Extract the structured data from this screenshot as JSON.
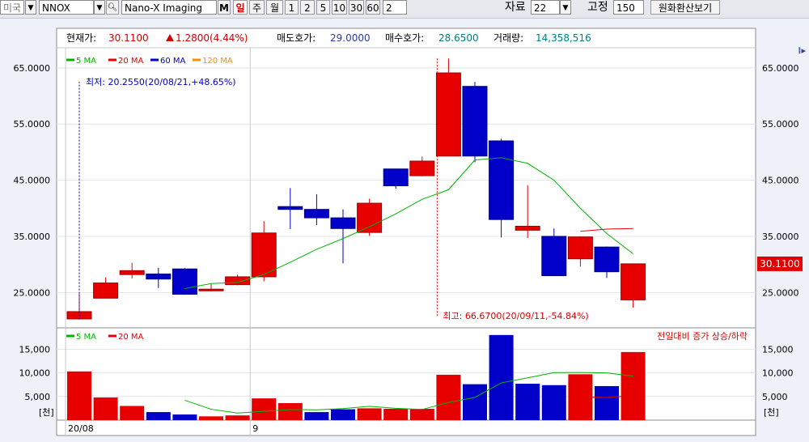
{
  "toolbar": {
    "market": "미국",
    "symbol": "NNOX",
    "name": "Nano-X Imaging",
    "m_label": "M",
    "periods": [
      "일",
      "주",
      "월",
      "1",
      "2",
      "5",
      "10",
      "30",
      "60"
    ],
    "active_period": "일",
    "custom_period": "2",
    "data_label": "자료",
    "data_value": "22",
    "fixed_label": "고정",
    "fixed_value": "150",
    "fx_button": "원화환산보기"
  },
  "info_bar": {
    "price_label": "현재가:",
    "price_value": "30.1100",
    "change_value": "1.2800(4.44%)",
    "ask_label": "매도호가:",
    "ask_value": "29.0000",
    "bid_label": "매수호가:",
    "bid_value": "28.6500",
    "volume_label": "거래량:",
    "volume_value": "14,358,516"
  },
  "colors": {
    "up": "#e60000",
    "down": "#0000c8",
    "ma5": "#00b400",
    "ma20": "#e60000",
    "ma60": "#0000c8",
    "ma120": "#ff8c00",
    "grid": "#e1e4ec"
  },
  "chart_data": [
    {
      "type": "candlestick",
      "legend": [
        "5 MA",
        "20 MA",
        "60 MA",
        "120 MA"
      ],
      "ylim": [
        19.0,
        68.0
      ],
      "yticks": [
        "65.0000",
        "55.0000",
        "45.0000",
        "35.0000",
        "25.0000"
      ],
      "ytick_values": [
        65,
        55,
        45,
        35,
        25
      ],
      "current_price_label": "30.1100",
      "current_price": 30.11,
      "low_annotation": "최저: 20.2550(20/08/21,+48.65%)",
      "high_annotation": "최고: 66.6700(20/09/11,-54.84%)",
      "low_marker_index": 0,
      "high_marker_index": 14,
      "candles": [
        {
          "o": 20.3,
          "h": 24.8,
          "l": 20.2,
          "c": 21.6
        },
        {
          "o": 24.0,
          "h": 27.7,
          "l": 24.0,
          "c": 26.7
        },
        {
          "o": 28.2,
          "h": 30.3,
          "l": 27.5,
          "c": 28.9
        },
        {
          "o": 28.3,
          "h": 29.4,
          "l": 25.8,
          "c": 27.4
        },
        {
          "o": 29.2,
          "h": 29.4,
          "l": 24.6,
          "c": 24.7
        },
        {
          "o": 25.3,
          "h": 26.5,
          "l": 25.2,
          "c": 25.6
        },
        {
          "o": 26.4,
          "h": 28.2,
          "l": 26.3,
          "c": 27.8
        },
        {
          "o": 27.8,
          "h": 37.7,
          "l": 27.0,
          "c": 35.6
        },
        {
          "o": 40.3,
          "h": 43.6,
          "l": 36.3,
          "c": 39.8
        },
        {
          "o": 39.8,
          "h": 42.5,
          "l": 37.0,
          "c": 38.3
        },
        {
          "o": 38.3,
          "h": 39.8,
          "l": 30.2,
          "c": 36.4
        },
        {
          "o": 35.7,
          "h": 41.7,
          "l": 35.1,
          "c": 40.9
        },
        {
          "o": 47.0,
          "h": 47.0,
          "l": 43.5,
          "c": 44.0
        },
        {
          "o": 45.8,
          "h": 49.2,
          "l": 45.7,
          "c": 48.4
        },
        {
          "o": 49.3,
          "h": 66.67,
          "l": 49.3,
          "c": 64.1
        },
        {
          "o": 61.7,
          "h": 62.5,
          "l": 48.2,
          "c": 49.3
        },
        {
          "o": 52.0,
          "h": 52.4,
          "l": 34.8,
          "c": 38.0
        },
        {
          "o": 36.1,
          "h": 44.1,
          "l": 34.7,
          "c": 36.8
        },
        {
          "o": 35.0,
          "h": 36.4,
          "l": 28.0,
          "c": 28.0
        },
        {
          "o": 31.0,
          "h": 35.0,
          "l": 29.6,
          "c": 34.9
        },
        {
          "o": 33.1,
          "h": 33.2,
          "l": 27.6,
          "c": 28.7
        },
        {
          "o": 23.7,
          "h": 30.1,
          "l": 22.3,
          "c": 30.11
        }
      ],
      "ma5": [
        null,
        null,
        null,
        null,
        25.7,
        26.6,
        26.8,
        28.2,
        30.4,
        32.7,
        34.6,
        36.7,
        39.0,
        41.6,
        43.3,
        48.6,
        49.0,
        48.0,
        45.0,
        40.0,
        35.5,
        31.9
      ],
      "ma20": [
        null,
        null,
        null,
        null,
        null,
        null,
        null,
        null,
        null,
        null,
        null,
        null,
        null,
        null,
        null,
        null,
        null,
        null,
        null,
        35.9,
        36.3,
        36.4
      ]
    },
    {
      "type": "bar",
      "legend": [
        "5 MA",
        "20 MA"
      ],
      "caption": "전일대비 증가 상승/하락",
      "unit_label": "[천]",
      "ylim": [
        0,
        19000
      ],
      "yticks": [
        "15,000",
        "10,000",
        "5,000"
      ],
      "ytick_values": [
        15000,
        10000,
        5000
      ],
      "x_labels": [
        {
          "index": 0,
          "text": "20/08"
        },
        {
          "index": 7,
          "text": "9"
        }
      ],
      "volumes": [
        10300,
        4800,
        3000,
        1700,
        1200,
        800,
        1000,
        4600,
        3600,
        1700,
        2300,
        2500,
        2400,
        2400,
        9600,
        7600,
        18000,
        7700,
        7400,
        9700,
        7200,
        14400
      ],
      "volume_up": [
        true,
        true,
        true,
        false,
        false,
        true,
        true,
        true,
        true,
        false,
        false,
        true,
        true,
        true,
        true,
        false,
        false,
        false,
        false,
        true,
        false,
        true
      ],
      "ma5": [
        null,
        null,
        null,
        null,
        4200,
        2300,
        1500,
        1860,
        2240,
        2180,
        2440,
        2940,
        2500,
        2260,
        3740,
        4820,
        7880,
        8940,
        10060,
        10080,
        10000,
        9300
      ],
      "ma20": [
        null,
        null,
        null,
        null,
        null,
        null,
        null,
        null,
        null,
        null,
        null,
        null,
        null,
        null,
        null,
        null,
        null,
        null,
        null,
        4950,
        4800,
        5200
      ]
    }
  ]
}
